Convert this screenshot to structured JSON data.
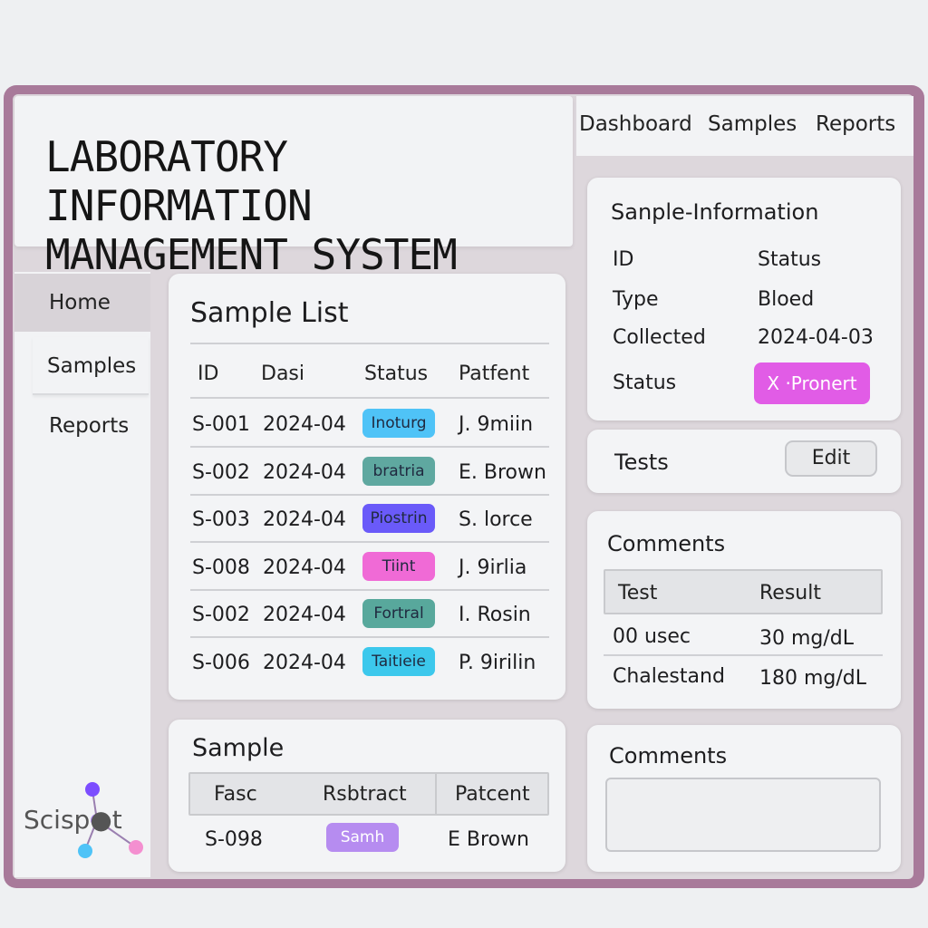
{
  "header": {
    "title_line1": "LABORATORY INFORMATION",
    "title_line2": "MANAGEMENT SYSTEM"
  },
  "topnav": [
    "Dashboard",
    "Samples",
    "Reports"
  ],
  "sidebar": {
    "items": [
      {
        "label": "Home",
        "active": true
      },
      {
        "label": "Samples",
        "active": false
      },
      {
        "label": "Reports",
        "active": false
      }
    ]
  },
  "logo": {
    "text": "Scisp●t"
  },
  "sample_list": {
    "title": "Sample List",
    "columns": [
      "ID",
      "Dasi",
      "Status",
      "Patfent"
    ],
    "rows": [
      {
        "id": "S-001",
        "date": "2024-04",
        "status": "Inoturg",
        "color": "#4fc3f7",
        "patient": "J. 9miin"
      },
      {
        "id": "S-002",
        "date": "2024-04",
        "status": "bratria",
        "color": "#5fa8a0",
        "patient": "E. Brown"
      },
      {
        "id": "S-003",
        "date": "2024-04",
        "status": "Piostrin",
        "color": "#6a5af9",
        "patient": "S. lorce"
      },
      {
        "id": "S-008",
        "date": "2024-04",
        "status": "Tiint",
        "color": "#f06ad6",
        "patient": "J. 9irlia"
      },
      {
        "id": "S-002",
        "date": "2024-04",
        "status": "Fortral",
        "color": "#58a89c",
        "patient": "I. Rosin"
      },
      {
        "id": "S-006",
        "date": "2024-04",
        "status": "Taitieie",
        "color": "#3cc8ec",
        "patient": "P. 9irilin"
      }
    ]
  },
  "sample_panel": {
    "title": "Sample",
    "columns": [
      "Fasc",
      "Rsbtract",
      "Patcent"
    ],
    "row": {
      "id": "S-098",
      "status": "Samh",
      "color": "#b68cf0",
      "patient": "E Brown"
    }
  },
  "sample_info": {
    "title": "Sanple-Information",
    "rows": [
      {
        "label": "ID",
        "value": "Status"
      },
      {
        "label": "Type",
        "value": "Bloed"
      },
      {
        "label": "Collected",
        "value": "2024-04-03"
      }
    ],
    "status_label": "Status",
    "status_badge": "Ⅹ ·Pronert",
    "status_color": "#e15ce6"
  },
  "tests": {
    "title": "Tests",
    "edit_label": "Edit"
  },
  "results": {
    "title": "Comments",
    "columns": [
      "Test",
      "Result"
    ],
    "rows": [
      {
        "test": "00 usec",
        "result": "30 mg/dL"
      },
      {
        "test": "Chalestand",
        "result": "180 mg/dL"
      }
    ]
  },
  "comments": {
    "title": "Comments",
    "value": ""
  }
}
